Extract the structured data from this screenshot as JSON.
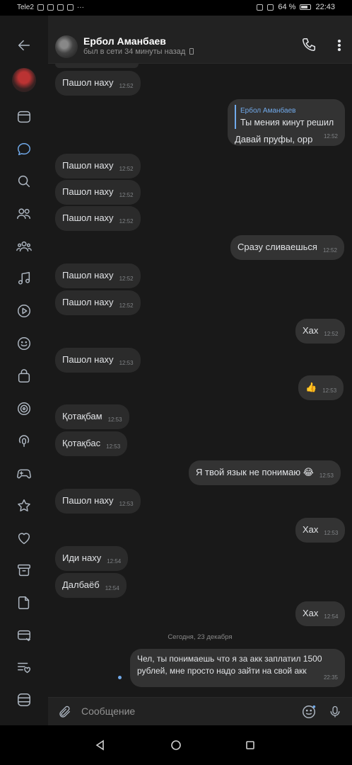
{
  "status_bar": {
    "carrier": "Tele2",
    "battery": "64 %",
    "time": "22:43"
  },
  "header": {
    "contact_name": "Ербол Аманбаев",
    "last_seen": "был в сети 34 минуты назад"
  },
  "messages": [
    {
      "text": "Пашол наху",
      "time": "12:52",
      "dir": "in"
    },
    {
      "reply_name": "Ербол Аманбаев",
      "reply_text": "Ты мения кинут решил",
      "text": "Давай пруфы, орр",
      "time": "12:52",
      "dir": "out"
    },
    {
      "text": "Пашол наху",
      "time": "12:52",
      "dir": "in"
    },
    {
      "text": "Пашол наху",
      "time": "12:52",
      "dir": "in"
    },
    {
      "text": "Пашол наху",
      "time": "12:52",
      "dir": "in"
    },
    {
      "text": "Сразу сливаешься",
      "time": "12:52",
      "dir": "out"
    },
    {
      "text": "Пашол наху",
      "time": "12:52",
      "dir": "in"
    },
    {
      "text": "Пашол наху",
      "time": "12:52",
      "dir": "in"
    },
    {
      "text": "Хах",
      "time": "12:52",
      "dir": "out"
    },
    {
      "text": "Пашол наху",
      "time": "12:53",
      "dir": "in"
    },
    {
      "text": "👍",
      "time": "12:53",
      "dir": "out"
    },
    {
      "text": "Қотақбам",
      "time": "12:53",
      "dir": "in"
    },
    {
      "text": "Қотақбас",
      "time": "12:53",
      "dir": "in"
    },
    {
      "text": "Я твой язык не понимаю 😂",
      "time": "12:53",
      "dir": "out"
    },
    {
      "text": "Пашол наху",
      "time": "12:53",
      "dir": "in"
    },
    {
      "text": "Хах",
      "time": "12:53",
      "dir": "out"
    },
    {
      "text": "Иди наху",
      "time": "12:54",
      "dir": "in"
    },
    {
      "text": "Далбаёб",
      "time": "12:54",
      "dir": "in"
    },
    {
      "text": "Хах",
      "time": "12:54",
      "dir": "out"
    },
    {
      "text_line1": "Чел, ты понимаешь что я за акк заплатил 1500",
      "text_line2": "рублей, мне просто надо зайти на свой акк",
      "time": "22:35",
      "dir": "out"
    }
  ],
  "date_separator": "Сегодня, 23 декабря",
  "composer": {
    "placeholder": "Сообщение"
  },
  "icons": {
    "rail": [
      "back-arrow-icon",
      "avatar",
      "news-icon",
      "messages-icon",
      "search-icon",
      "friends-icon",
      "communities-icon",
      "music-icon",
      "video-icon",
      "games-smile-icon",
      "shop-bag-icon",
      "stories-icon",
      "podcast-icon",
      "gamepad-icon",
      "star-icon",
      "heart-icon",
      "archive-icon",
      "document-icon",
      "payment-icon",
      "list-heart-icon",
      "apps-icon"
    ]
  },
  "colors": {
    "accent": "#71aaeb",
    "background": "#191919",
    "bubble_in": "#2b2b2b",
    "bubble_out": "#333333"
  }
}
